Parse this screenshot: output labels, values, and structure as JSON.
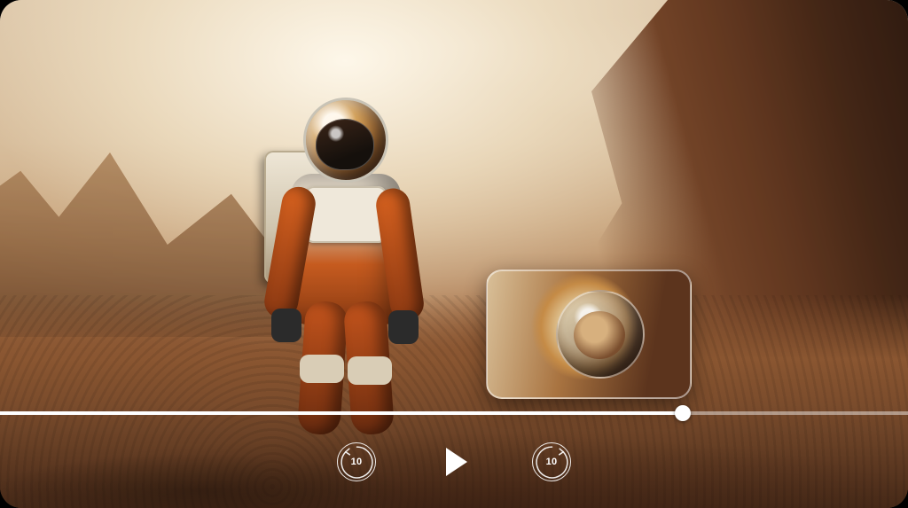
{
  "player": {
    "progress_percent": 75.2,
    "controls": {
      "skip_back_seconds": "10",
      "skip_forward_seconds": "10"
    },
    "icons": {
      "skip_back": "skip-back-10-icon",
      "play": "play-icon",
      "skip_forward": "skip-forward-10-icon"
    },
    "colors": {
      "progress_track": "rgba(255,255,255,0.45)",
      "progress_fill": "#ffffff",
      "control_outline": "rgba(255,255,255,0.9)"
    }
  }
}
